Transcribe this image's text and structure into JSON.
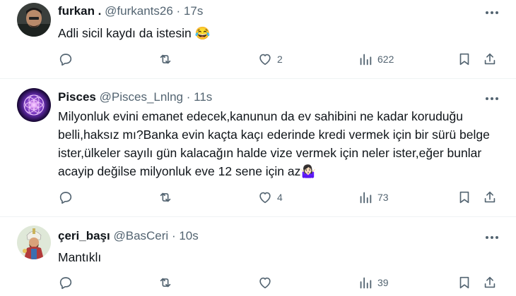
{
  "tweets": [
    {
      "name": "furkan .",
      "handle": "@furkants26",
      "dot": "·",
      "time": "17s",
      "text": "Adli sicil kaydı da istesin 😂",
      "likes": "2",
      "views": "622",
      "avatar_icon": "person-photo-icon"
    },
    {
      "name": "Pisces",
      "handle": "@Pisces_Lnlng",
      "dot": "·",
      "time": "11s",
      "text": "Milyonluk evini emanet edecek,kanunun da ev sahibini ne kadar koruduğu belli,haksız mı?Banka evin kaçta kaçı ederinde kredi vermek için bir sürü belge ister,ülkeler sayılı gün kalacağın halde vize vermek için neler ister,eğer bunlar acayip değilse milyonluk eve 12 sene için az🤷🏻‍♀️",
      "likes": "4",
      "views": "73",
      "avatar_icon": "flower-of-life-icon"
    },
    {
      "name": "çeri_başı",
      "handle": "@BasCeri",
      "dot": "·",
      "time": "10s",
      "text": "Mantıklı",
      "likes": "",
      "views": "39",
      "avatar_icon": "janissary-figure-icon"
    }
  ],
  "colors": {
    "text": "#0f1419",
    "secondary": "#536471",
    "divider": "#eff3f4"
  }
}
